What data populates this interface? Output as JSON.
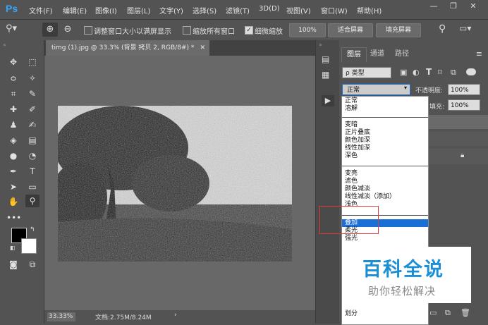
{
  "app": {
    "logo": "Ps"
  },
  "menubar": {
    "items": [
      "文件(F)",
      "编辑(E)",
      "图像(I)",
      "图层(L)",
      "文字(Y)",
      "选择(S)",
      "滤镜(T)",
      "3D(D)",
      "视图(V)",
      "窗口(W)",
      "帮助(H)"
    ]
  },
  "options": {
    "resize_window": "调整窗口大小以满屏显示",
    "zoom_all": "缩放所有窗口",
    "scrubby_zoom": "细微缩放",
    "zoom_pct": "100%",
    "fit_screen": "适合屏幕",
    "fill_screen": "填充屏幕"
  },
  "document": {
    "tab_title": "timg (1).jpg @ 33.3% (背景 拷贝 2, RGB/8#) *",
    "zoom": "33.33%",
    "doc_info": "文档:2.75M/8.24M"
  },
  "layers_panel": {
    "tabs": [
      "图层",
      "通道",
      "路径"
    ],
    "filter_label": "ρ 类型",
    "blend_mode": "正常",
    "opacity_label": "不透明度:",
    "opacity_value": "100%",
    "fill_label": "填充:",
    "fill_value": "100%"
  },
  "blend_modes": {
    "group1": [
      "正常",
      "溶解"
    ],
    "group2": [
      "变暗",
      "正片叠底",
      "颜色加深",
      "线性加深",
      "深色"
    ],
    "group3": [
      "变亮",
      "滤色",
      "颜色减淡",
      "线性减淡（添加）",
      "浅色"
    ],
    "group4": [
      "叠加",
      "柔光",
      "强光"
    ],
    "group5_partial": [
      "划分"
    ],
    "selected": "叠加"
  },
  "watermark": {
    "title": "百科全说",
    "subtitle": "助你轻松解决",
    "title_color": "#1a8fd6"
  },
  "colors": {
    "accent": "#31a8ff",
    "selection": "#1a6fd6",
    "highlight_box": "#e03a3a"
  }
}
